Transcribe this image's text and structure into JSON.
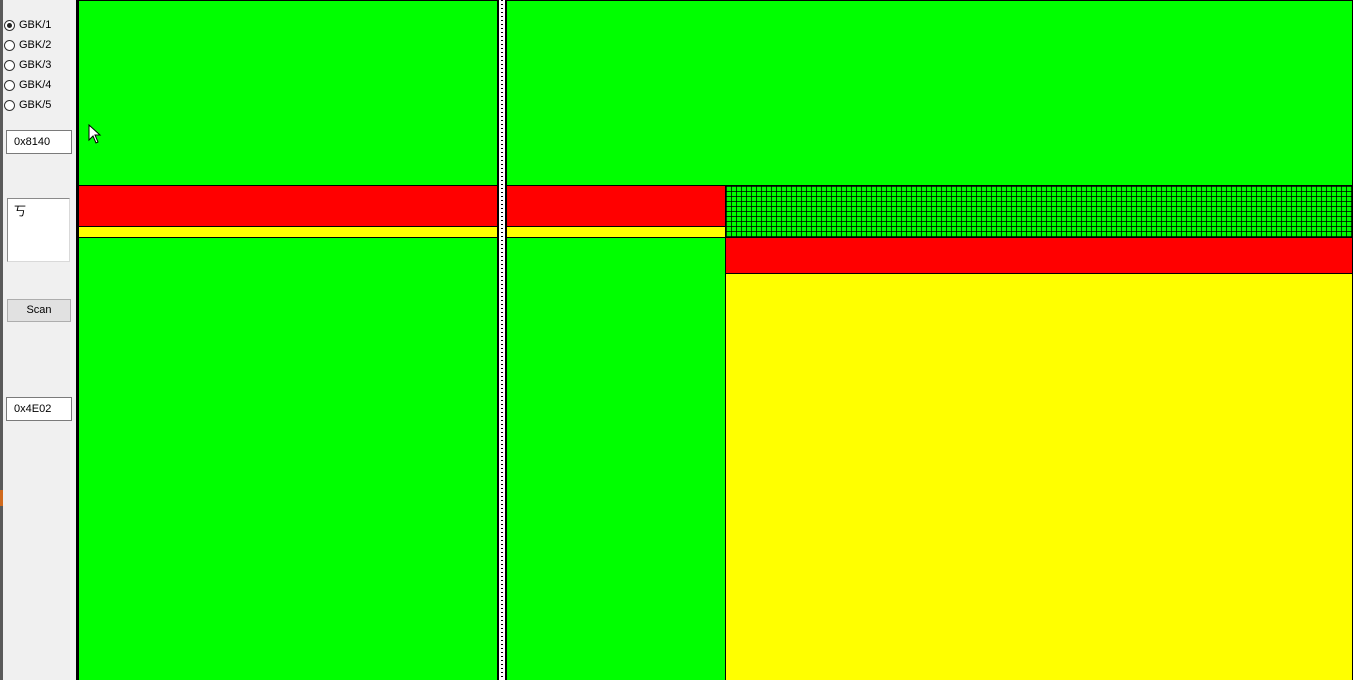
{
  "encoding_options": [
    {
      "label": "GBK/1",
      "checked": true
    },
    {
      "label": "GBK/2",
      "checked": false
    },
    {
      "label": "GBK/3",
      "checked": false
    },
    {
      "label": "GBK/4",
      "checked": false
    },
    {
      "label": "GBK/5",
      "checked": false
    }
  ],
  "start_code_field": {
    "value": "0x8140"
  },
  "glyph_preview": {
    "text": "丂"
  },
  "scan_button": {
    "label": "Scan"
  },
  "result_code_field": {
    "value": "0x4E02"
  },
  "colors": {
    "valid_region": "#00ff00",
    "invalid_region": "#ff0000",
    "partial_region": "#ffff00",
    "grid_line": "#000000",
    "sidebar_bg": "#f0f0f0"
  }
}
